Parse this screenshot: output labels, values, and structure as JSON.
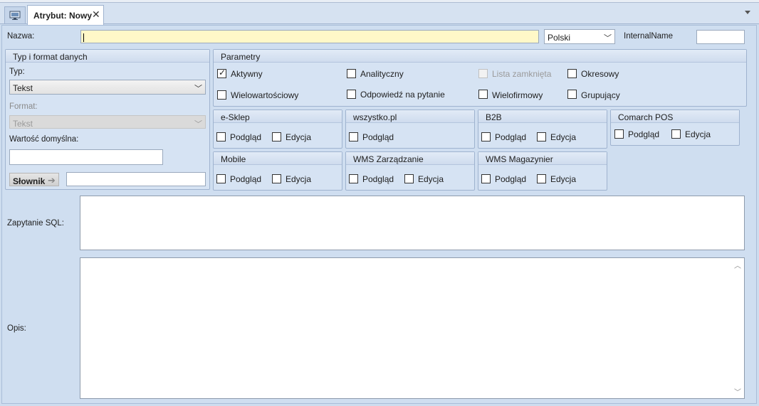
{
  "window": {
    "tab_title": "Atrybut: Nowy",
    "tab_close": "✕"
  },
  "header": {
    "nazwa_label": "Nazwa:",
    "nazwa_value": "",
    "language_value": "Polski",
    "internal_name_label": "InternalName",
    "internal_name_value": ""
  },
  "typ_group": {
    "title": "Typ i format danych",
    "typ_label": "Typ:",
    "typ_value": "Tekst",
    "format_label": "Format:",
    "format_value": "Tekst",
    "default_label": "Wartość domyślna:",
    "default_value": "",
    "slownik_label": "Słownik",
    "slownik_value": ""
  },
  "parametry": {
    "title": "Parametry",
    "items": [
      {
        "label": "Aktywny",
        "checked": true,
        "enabled": true
      },
      {
        "label": "Analityczny",
        "checked": false,
        "enabled": true
      },
      {
        "label": "Lista zamknięta",
        "checked": false,
        "enabled": false
      },
      {
        "label": "Okresowy",
        "checked": false,
        "enabled": true
      },
      {
        "label": "Wielowartościowy",
        "checked": false,
        "enabled": true
      },
      {
        "label": "Odpowiedź na pytanie",
        "checked": false,
        "enabled": true
      },
      {
        "label": "Wielofirmowy",
        "checked": false,
        "enabled": true
      },
      {
        "label": "Grupujący",
        "checked": false,
        "enabled": true
      }
    ]
  },
  "channels": {
    "podglad": "Podgląd",
    "edycja": "Edycja",
    "eshop": "e-Sklep",
    "wszystko": "wszystko.pl",
    "b2b": "B2B",
    "pos": "Comarch POS",
    "mobile": "Mobile",
    "wms_zarz": "WMS Zarządzanie",
    "wms_mag": "WMS Magazynier"
  },
  "sql": {
    "label": "Zapytanie SQL:",
    "value": ""
  },
  "opis": {
    "label": "Opis:",
    "value": ""
  }
}
